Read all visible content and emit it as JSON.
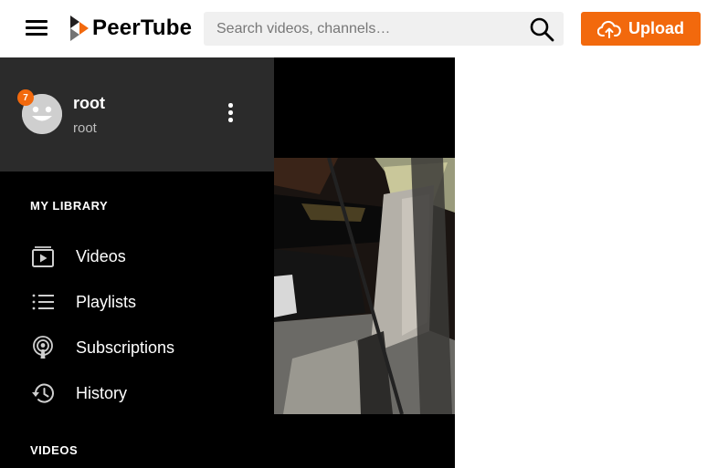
{
  "header": {
    "logo_text": "PeerTube",
    "search_placeholder": "Search videos, channels…",
    "upload_label": "Upload"
  },
  "user": {
    "display_name": "root",
    "username": "root",
    "notification_count": "7"
  },
  "sidebar": {
    "library_title": "MY LIBRARY",
    "items": [
      {
        "label": "Videos",
        "icon": "videos-icon"
      },
      {
        "label": "Playlists",
        "icon": "playlists-icon"
      },
      {
        "label": "Subscriptions",
        "icon": "subscriptions-icon"
      },
      {
        "label": "History",
        "icon": "history-icon"
      }
    ],
    "videos_title": "VIDEOS"
  },
  "colors": {
    "accent": "#f2690d",
    "sidebar_bg": "#000000",
    "user_panel_bg": "#2b2b2b",
    "search_bg": "#f0f0f0"
  }
}
